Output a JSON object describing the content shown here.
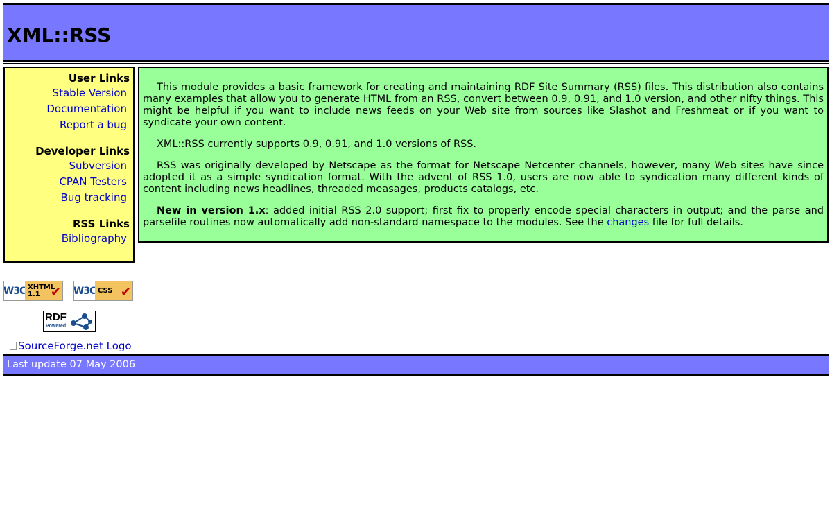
{
  "header": {
    "title": "XML::RSS"
  },
  "sidebar": {
    "groups": [
      {
        "title": "User Links",
        "links": [
          "Stable Version",
          "Documentation",
          "Report a bug"
        ]
      },
      {
        "title": "Developer Links",
        "links": [
          "Subversion",
          "CPAN Testers",
          "Bug tracking"
        ]
      },
      {
        "title": "RSS Links",
        "links": [
          "Bibliography"
        ]
      }
    ]
  },
  "content": {
    "p1": "This module provides a basic framework for creating and maintaining RDF Site Summary (RSS) files. This distribution also contains many examples that allow you to generate HTML from an RSS, convert between 0.9, 0.91, and 1.0 version, and other nifty things. This might be helpful if you want to include news feeds on your Web site from sources like Slashot and Freshmeat or if you want to syndicate your own content.",
    "p2": "XML::RSS currently supports 0.9, 0.91, and 1.0 versions of RSS.",
    "p3": "RSS was originally developed by Netscape as the format for Netscape Netcenter channels, however, many Web sites have since adopted it as a simple syndication format. With the advent of RSS 1.0, users are now able to syndication many different kinds of content including news headlines, threaded measages, products catalogs, etc.",
    "p4_bold": "New in version 1.x",
    "p4_text": ": added initial RSS 2.0 support; first fix to properly encode special characters in output; and the parse and parsefile routines now automatically add non-standard namespace to the modules. See the ",
    "p4_link": "changes",
    "p4_end": " file for full details."
  },
  "badges": {
    "w3c": "W3C",
    "xhtml_label": "XHTML",
    "xhtml_version": "1.1",
    "css_label": "CSS",
    "rdf_text": "RDF",
    "rdf_sub": "Powered",
    "sourceforge_alt": "SourceForge.net Logo"
  },
  "footer": {
    "last_update": "Last update 07 May 2006"
  },
  "colors": {
    "header_bg": "#7777ff",
    "sidebar_bg": "#ffff80",
    "content_bg": "#99ff99",
    "link": "#0000cc"
  }
}
